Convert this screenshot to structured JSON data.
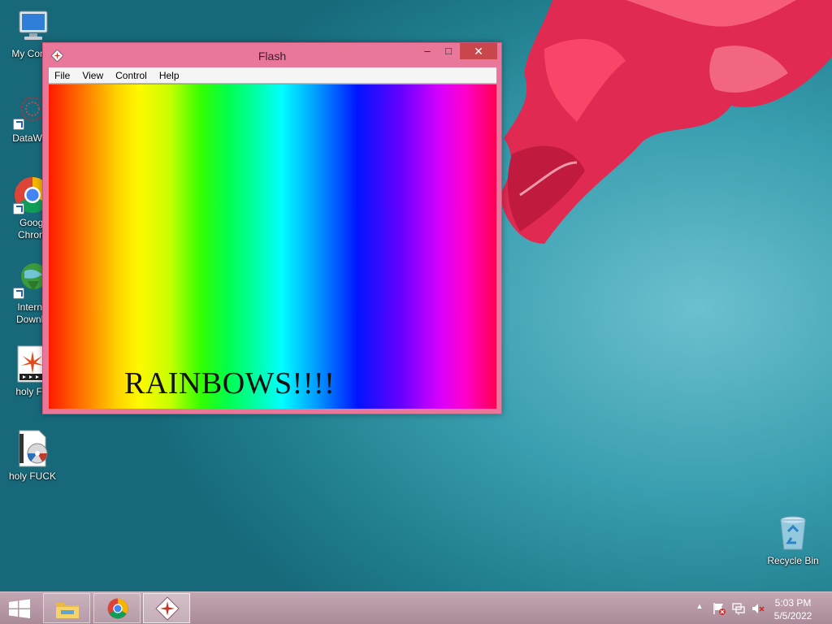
{
  "desktop": {
    "icons": [
      {
        "label": "My Comp",
        "icon": "computer-icon"
      },
      {
        "label": "DataWag",
        "icon": "datawag-icon"
      },
      {
        "label_line1": "Googl",
        "label_line2": "Chrom",
        "icon": "chrome-icon"
      },
      {
        "label_line1": "Interne",
        "label_line2": "Downlo",
        "icon": "internet-download-icon"
      },
      {
        "label": "holy FU",
        "icon": "flash-movie-icon"
      },
      {
        "label": "holy FUCK",
        "icon": "video-file-icon"
      },
      {
        "label": "Recycle Bin",
        "icon": "recycle-bin-icon"
      }
    ]
  },
  "window": {
    "title": "Flash",
    "controls": {
      "minimize": "–",
      "maximize": "□",
      "close": "✕"
    },
    "menu": [
      "File",
      "View",
      "Control",
      "Help"
    ],
    "stage_text": "RAINBOWS!!!!"
  },
  "taskbar": {
    "items": [
      {
        "name": "file-explorer",
        "icon": "folder-icon"
      },
      {
        "name": "google-chrome",
        "icon": "chrome-icon"
      },
      {
        "name": "flash-player",
        "icon": "flash-icon",
        "active": true
      }
    ],
    "tray": {
      "show_hidden": "▲",
      "icons": [
        "action-center-flag-icon",
        "network-icon",
        "volume-muted-icon"
      ]
    },
    "clock": {
      "time": "5:03 PM",
      "date": "5/5/2022"
    }
  },
  "colors": {
    "window_frame": "#e8779a",
    "close_button": "#c9464d",
    "taskbar": "#b898a7"
  }
}
